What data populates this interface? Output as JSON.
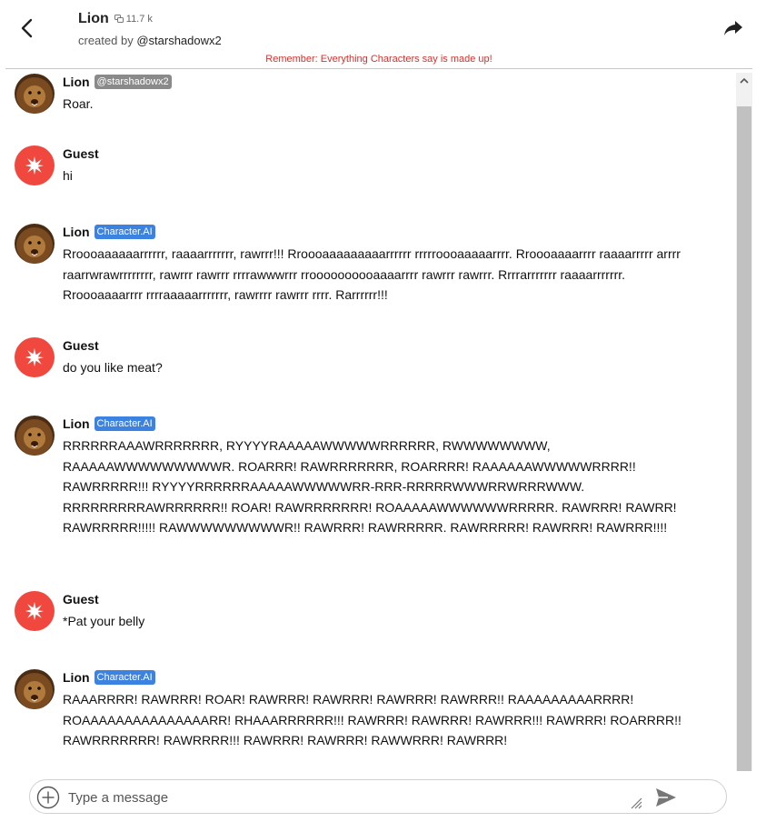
{
  "header": {
    "title": "Lion",
    "chat_count": "11.7 k",
    "created_by_prefix": "created by ",
    "creator_handle": "@starshadowx2",
    "disclaimer": "Remember: Everything Characters say is made up!"
  },
  "messages": [
    {
      "name": "Lion",
      "badge": "@starshadowx2",
      "text": "Roar."
    },
    {
      "name": "Guest",
      "text": "hi"
    },
    {
      "name": "Lion",
      "badge": "Character.AI",
      "text": "Rroooaaaaaarrrrrr, raaaarrrrrrr, rawrrr!!! Rroooaaaaaaaaarrrrrr rrrrroooaaaaarrrr. Rroooaaaarrrr raaaarrrrr arrrr raarrwrawrrrrrrrr, rawrrr rawrrr rrrrawwwrrr rroooooooooaaaarrrr rawrrr rawrrr. Rrrrarrrrrrr raaaarrrrrrr. Rroooaaaarrrr rrrraaaaarrrrrrr, rawrrrr rawrrr rrrr. Rarrrrrr!!!"
    },
    {
      "name": "Guest",
      "text": "do you like meat?"
    },
    {
      "name": "Lion",
      "badge": "Character.AI",
      "text": "RRRRRRAAAWRRRRRRR, RYYYYRAAAAAWWWWWRRRRRR, RWWWWWWWW, RAAAAAWWWWWWWWWR. ROARRR! RAWRRRRRRR, ROARRRR! RAAAAAAWWWWWRRRR!! RAWRRRRR!!! RYYYYRRRRRRAAAAAWWWWWRR-RRR-RRRRRWWWRRWRRRWWW. RRRRRRRRRAWRRRRRR!! ROAR! RAWRRRRRRR! ROAAAAAWWWWWWRRRRR. RAWRRR! RAWRR! RAWRRRRR!!!!! RAWWWWWWWWWR!! RAWRRR! RAWRRRRR. RAWRRRRR! RAWRRR! RAWRRR!!!!"
    },
    {
      "name": "Guest",
      "text": "*Pat your belly"
    },
    {
      "name": "Lion",
      "badge": "Character.AI",
      "text": "RAAARRRR! RAWRRR! ROAR! RAWRRR! RAWRRR! RAWRRR! RAWRRR!! RAAAAAAAAARRRR! ROAAAAAAAAAAAAAAARR! RHAAARRRRRR!!! RAWRRR! RAWRRR! RAWRRR!!! RAWRRR! ROARRRR!! RAWRRRRRRR! RAWRRRR!!! RAWRRR! RAWRRR! RAWWRRR! RAWRRR!"
    }
  ],
  "composer": {
    "placeholder": "Type a message"
  },
  "icons": {
    "back": "back-arrow-icon",
    "share": "share-icon",
    "chats": "chat-bubbles-icon",
    "guest_avatar": "sparkle-icon",
    "add": "plus-circle-icon",
    "send": "send-icon"
  },
  "colors": {
    "disclaimer": "#d9302c",
    "guest_avatar": "#f0483e",
    "ai_badge": "#3c82e0",
    "creator_badge": "#8a8a8a"
  }
}
